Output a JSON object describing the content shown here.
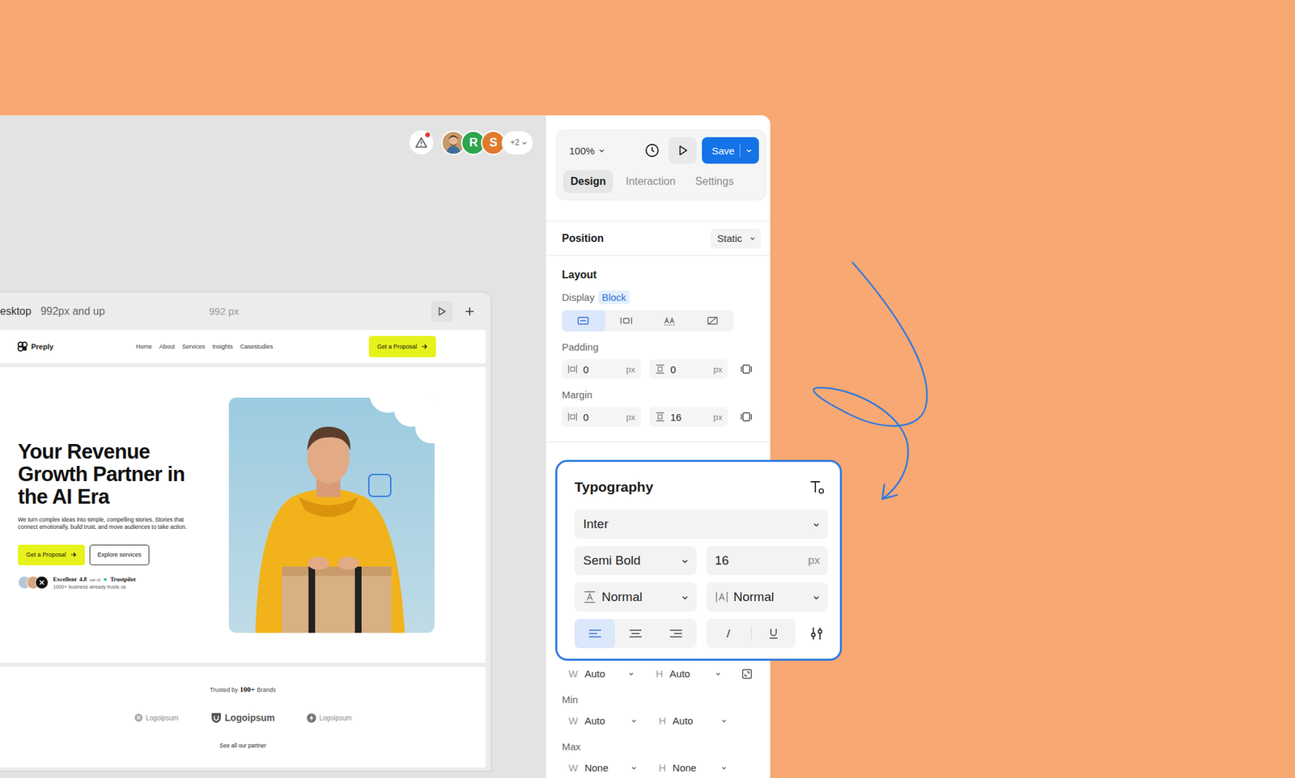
{
  "canvas": {
    "alert": true,
    "collaborators": [
      {
        "kind": "photo",
        "initial": "",
        "color": "#c79a6b"
      },
      {
        "kind": "letter",
        "initial": "R",
        "color": "#2ea44f"
      },
      {
        "kind": "letter",
        "initial": "S",
        "color": "#e07a2e"
      }
    ],
    "more": "+2"
  },
  "breakpoint": {
    "name": "esktop",
    "range": "992px and up",
    "width": "992 px"
  },
  "site": {
    "brand": "Preply",
    "nav": [
      "Home",
      "About",
      "Services",
      "Insights",
      "Casestudies"
    ],
    "nav_cta": "Get a Proposal",
    "hero": {
      "title": "Your Revenue Growth Partner in the AI Era",
      "text": "We turn complex ideas into simple, compelling stories. Stories that connect emotionally, build trust, and move audiences to take action.",
      "primary": "Get a Proposal",
      "secondary": "Explore services",
      "selected_element": true,
      "rating": {
        "label": "Excellent",
        "score": "4.8",
        "out_of": "out of",
        "star": "★",
        "source": "Trustpilot",
        "note": "1000+ business already trusts us"
      }
    },
    "trusted": {
      "prefix": "Trusted by",
      "count": "100+",
      "suffix": "Brands",
      "logos": [
        {
          "kind": "circle",
          "name": "Logoipsum",
          "bold": false
        },
        {
          "kind": "shield",
          "name": "Logoipsum",
          "bold": true
        },
        {
          "kind": "bolt",
          "name": "Logoipsum",
          "bold": false
        }
      ],
      "link": "See all our partner"
    }
  },
  "panel": {
    "zoom": "100%",
    "save": "Save",
    "tabs": [
      {
        "label": "Design",
        "selected": true
      },
      {
        "label": "Interaction",
        "selected": false
      },
      {
        "label": "Settings",
        "selected": false
      }
    ],
    "position": {
      "label": "Position",
      "value": "Static"
    },
    "layout": {
      "title": "Layout",
      "display_label": "Display",
      "display_value": "Block",
      "display_options": [
        {
          "kind": "block",
          "selected": true
        },
        {
          "kind": "flex",
          "selected": false
        },
        {
          "kind": "inline",
          "selected": false
        },
        {
          "kind": "none",
          "selected": false
        }
      ],
      "spacing": [
        {
          "label": "Padding",
          "fields": [
            {
              "kind": "x",
              "value": "0",
              "unit": "px"
            },
            {
              "kind": "y",
              "value": "0",
              "unit": "px"
            }
          ]
        },
        {
          "label": "Margin",
          "fields": [
            {
              "kind": "x",
              "value": "0",
              "unit": "px"
            },
            {
              "kind": "y",
              "value": "16",
              "unit": "px"
            }
          ]
        }
      ]
    },
    "size": [
      {
        "label": "",
        "fields": [
          {
            "axis": "W",
            "value": "Auto"
          },
          {
            "axis": "H",
            "value": "Auto"
          }
        ]
      },
      {
        "label": "Min",
        "fields": [
          {
            "axis": "W",
            "value": "Auto"
          },
          {
            "axis": "H",
            "value": "Auto"
          }
        ]
      },
      {
        "label": "Max",
        "fields": [
          {
            "axis": "W",
            "value": "None"
          },
          {
            "axis": "H",
            "value": "None"
          }
        ]
      }
    ]
  },
  "typography": {
    "title": "Typography",
    "family": "Inter",
    "weight": "Semi Bold",
    "size": "16",
    "unit": "px",
    "line_height": "Normal",
    "letter_spacing": "Normal",
    "align": [
      {
        "kind": "left",
        "selected": true
      },
      {
        "kind": "center",
        "selected": false
      },
      {
        "kind": "right",
        "selected": false
      }
    ],
    "styles": [
      {
        "kind": "italic",
        "selected": false
      },
      {
        "kind": "underline",
        "selected": false
      }
    ]
  }
}
